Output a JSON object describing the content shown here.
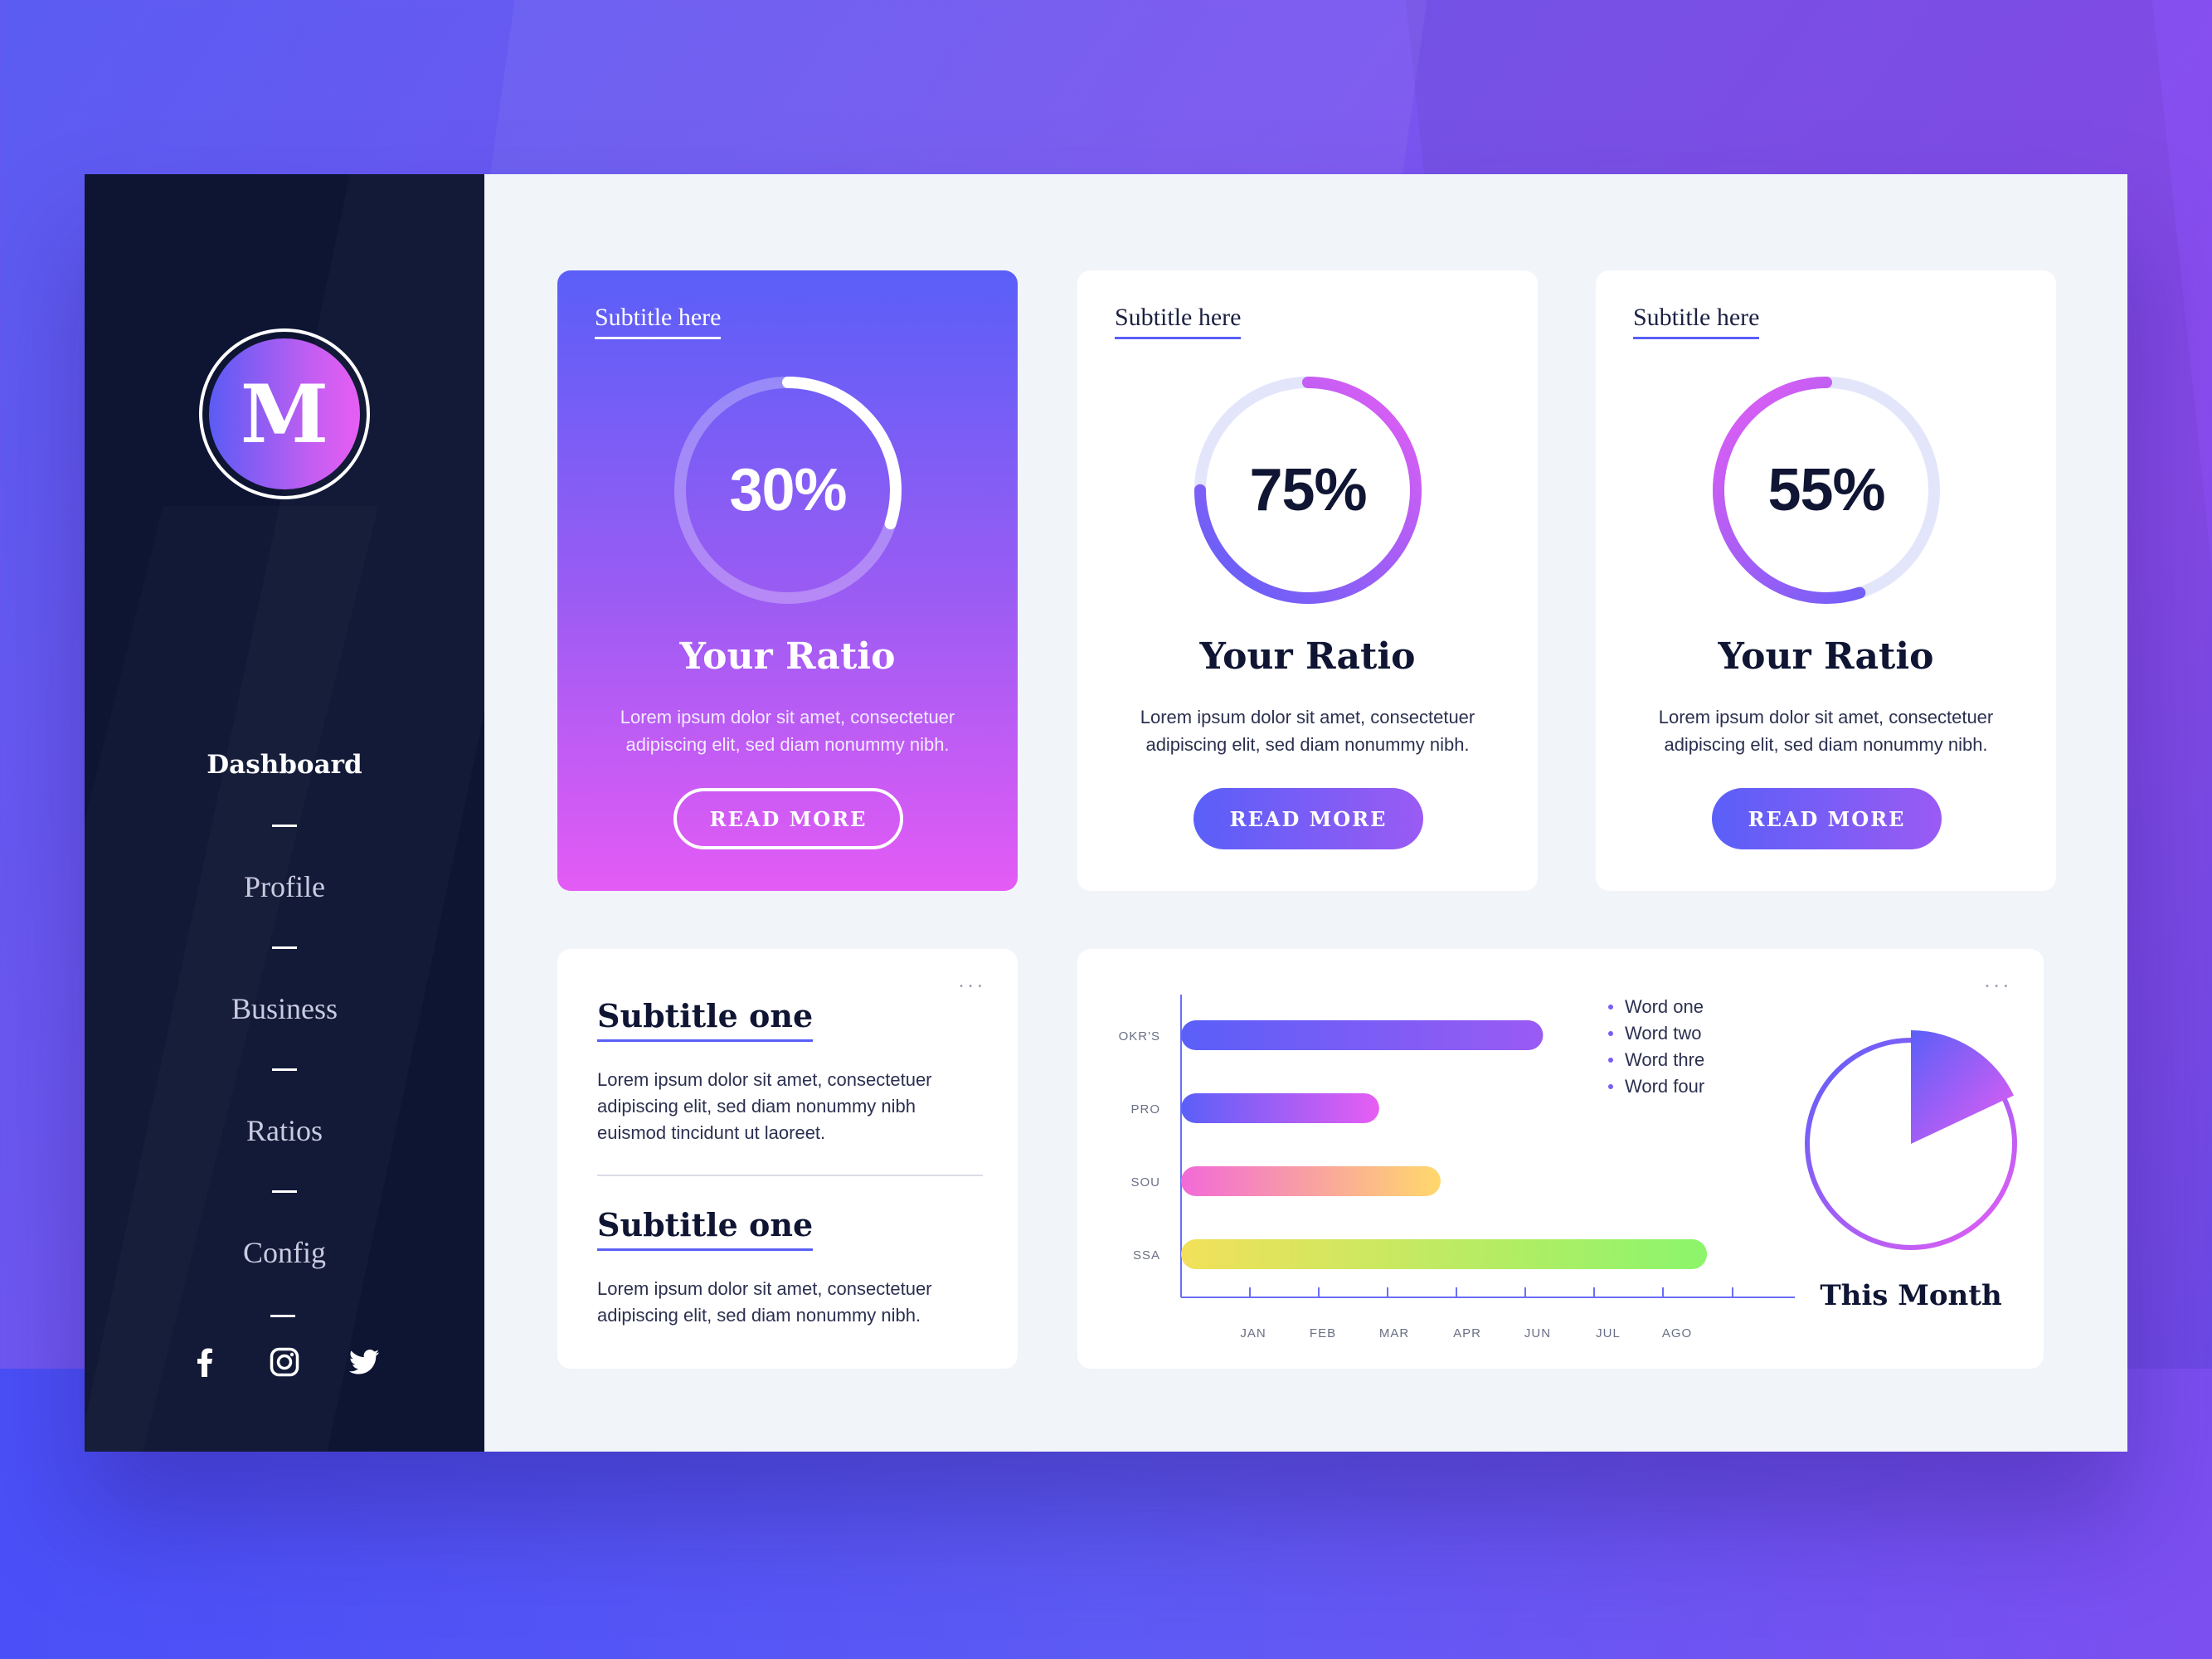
{
  "sidebar": {
    "logo_letter": "M",
    "nav": [
      {
        "label": "Dashboard",
        "active": true
      },
      {
        "label": "Profile",
        "active": false
      },
      {
        "label": "Business",
        "active": false
      },
      {
        "label": "Ratios",
        "active": false
      },
      {
        "label": "Config",
        "active": false
      }
    ],
    "social": [
      "facebook-icon",
      "instagram-icon",
      "twitter-icon"
    ]
  },
  "ratio_cards": [
    {
      "subtitle": "Subtitle here",
      "value_label": "30%",
      "progress": 0.3,
      "title": "Your Ratio",
      "description": "Lorem ipsum dolor sit amet, consectetuer adipiscing elit, sed diam nonummy nibh.",
      "button": "READ MORE",
      "highlighted": true
    },
    {
      "subtitle": "Subtitle here",
      "value_label": "75%",
      "progress": 0.75,
      "title": "Your Ratio",
      "description": "Lorem ipsum dolor sit amet, consectetuer adipiscing elit, sed diam nonummy nibh.",
      "button": "READ MORE",
      "highlighted": false
    },
    {
      "subtitle": "Subtitle here",
      "value_label": "55%",
      "progress": 0.55,
      "title": "Your Ratio",
      "description": "Lorem ipsum dolor sit amet, consectetuer adipiscing elit, sed diam nonummy nibh.",
      "button": "READ MORE",
      "highlighted": false
    }
  ],
  "info_card": {
    "menu": "...",
    "sections": [
      {
        "subtitle": "Subtitle one",
        "text": "Lorem ipsum dolor sit amet, consectetuer adipiscing elit, sed diam nonummy nibh euismod tincidunt ut laoreet."
      },
      {
        "subtitle": "Subtitle one",
        "text": "Lorem ipsum dolor sit amet, consectetuer adipiscing elit, sed diam nonummy nibh."
      }
    ]
  },
  "chart_card": {
    "menu": "...",
    "pie_label": "This Month"
  },
  "chart_data": [
    {
      "type": "bar",
      "orientation": "horizontal",
      "categories": [
        "OKR'S",
        "PRO",
        "SOU",
        "SSA"
      ],
      "values": [
        5.3,
        2.9,
        3.8,
        7.7
      ],
      "x_tick_labels": [
        "JAN",
        "FEB",
        "MAR",
        "APR",
        "JUN",
        "JUL",
        "AGO"
      ],
      "xlim": [
        0,
        8.5
      ],
      "legend": [
        "Word one",
        "Word two",
        "Word thre",
        "Word four"
      ],
      "legend_position": "top-right",
      "grid": false,
      "bar_colors": [
        [
          "#5a5ff8",
          "#9a5bf3"
        ],
        [
          "#5a5ff8",
          "#e75ef3"
        ],
        [
          "#f26ad8",
          "#ffd86b"
        ],
        [
          "#f2e05a",
          "#8bf56b"
        ]
      ]
    },
    {
      "type": "pie",
      "values": [
        0.18,
        0.82
      ],
      "labels": [
        "",
        ""
      ],
      "title": "This Month"
    }
  ],
  "colors": {
    "accent": "#5a5ff8",
    "accent2": "#e75ef3",
    "sidebar": "#0e1533",
    "content_bg": "#f1f4f9"
  }
}
